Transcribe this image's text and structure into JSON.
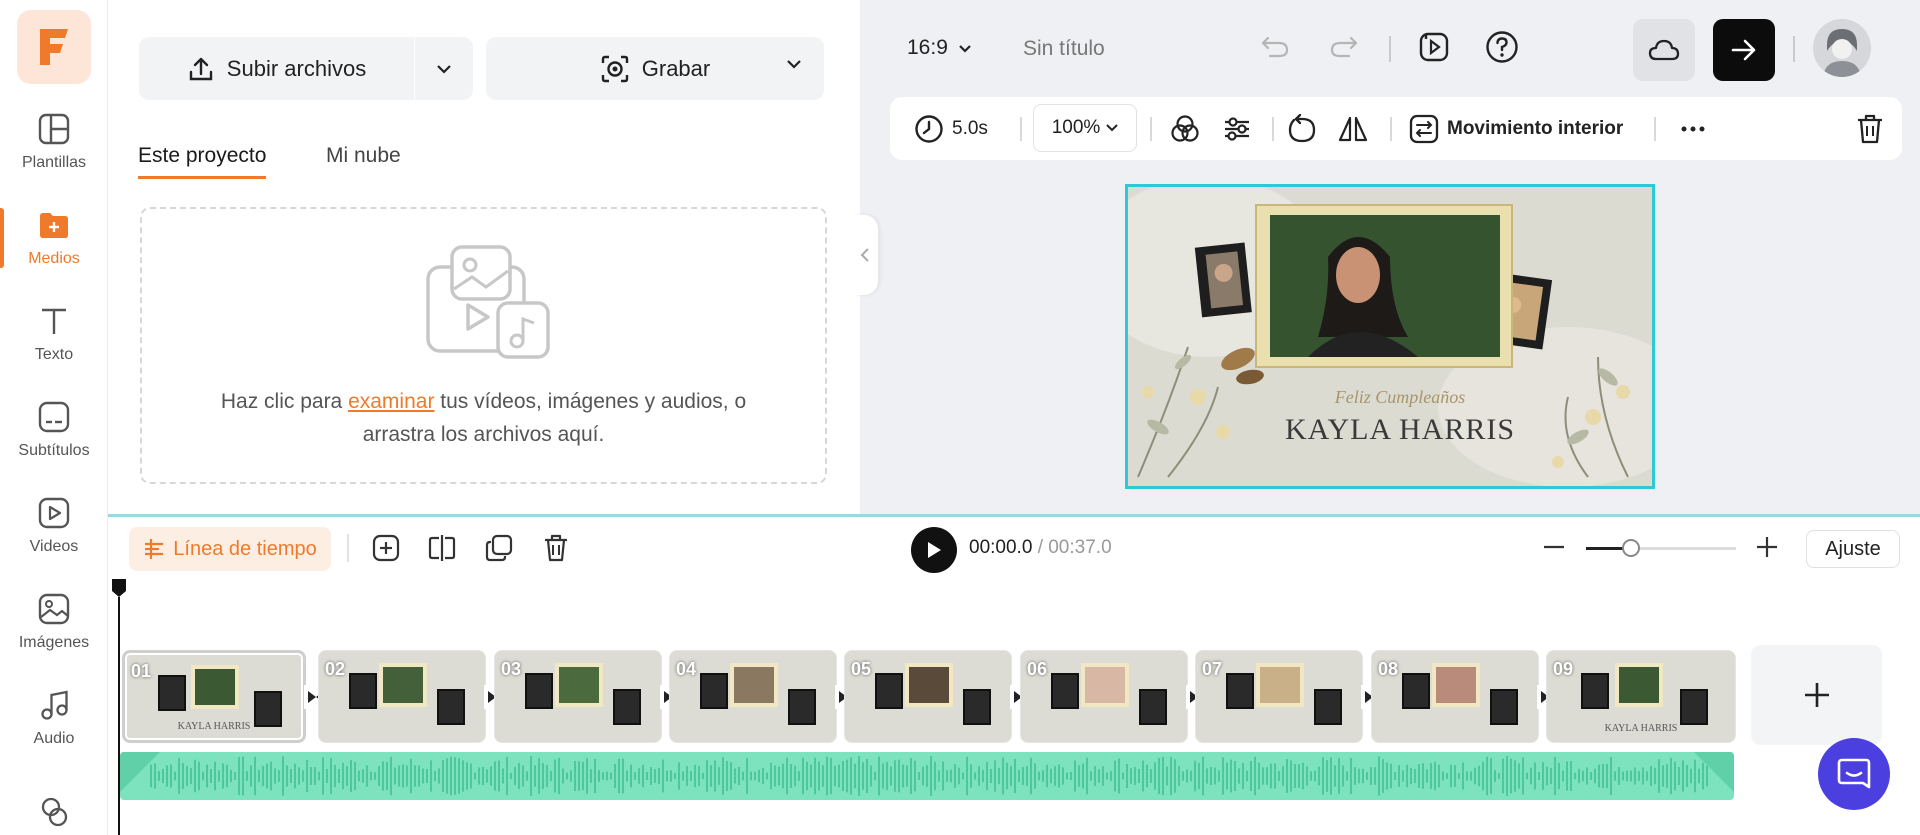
{
  "sidebar": {
    "items": [
      {
        "label": "Plantillas",
        "icon": "templates-icon"
      },
      {
        "label": "Medios",
        "icon": "media-icon",
        "active": true
      },
      {
        "label": "Texto",
        "icon": "text-icon"
      },
      {
        "label": "Subtítulos",
        "icon": "subtitles-icon"
      },
      {
        "label": "Videos",
        "icon": "videos-icon"
      },
      {
        "label": "Imágenes",
        "icon": "images-icon"
      },
      {
        "label": "Audio",
        "icon": "audio-icon"
      },
      {
        "label": "",
        "icon": "elements-icon"
      }
    ]
  },
  "media": {
    "upload_label": "Subir archivos",
    "record_label": "Grabar",
    "tabs": [
      {
        "label": "Este proyecto",
        "active": true
      },
      {
        "label": "Mi nube",
        "active": false
      }
    ],
    "dropzone": {
      "text_before": "Haz clic para ",
      "link": "examinar",
      "text_after": " tus vídeos, imágenes y audios, o",
      "line2": "arrastra los archivos aquí."
    }
  },
  "header": {
    "ratio": "16:9",
    "title": "Sin título"
  },
  "clip_toolbar": {
    "duration": "5.0s",
    "zoom": "100%",
    "motion_label": "Movimiento interior"
  },
  "canvas": {
    "script_text": "Feliz Cumpleaños",
    "name_text": "KAYLA HARRIS"
  },
  "timeline": {
    "mode_label": "Línea de tiempo",
    "current_time": "00:00.0",
    "total_time": "/ 00:37.0",
    "zoom_level": 0.3,
    "fit_label": "Ajuste",
    "clips": [
      "01",
      "02",
      "03",
      "04",
      "05",
      "06",
      "07",
      "08",
      "09"
    ],
    "clip_caption": "KAYLA HARRIS"
  },
  "colors": {
    "accent": "#f07a2b",
    "selection": "#2cc9d6",
    "audio": "#7de3bf",
    "chat": "#4b3fe0"
  }
}
